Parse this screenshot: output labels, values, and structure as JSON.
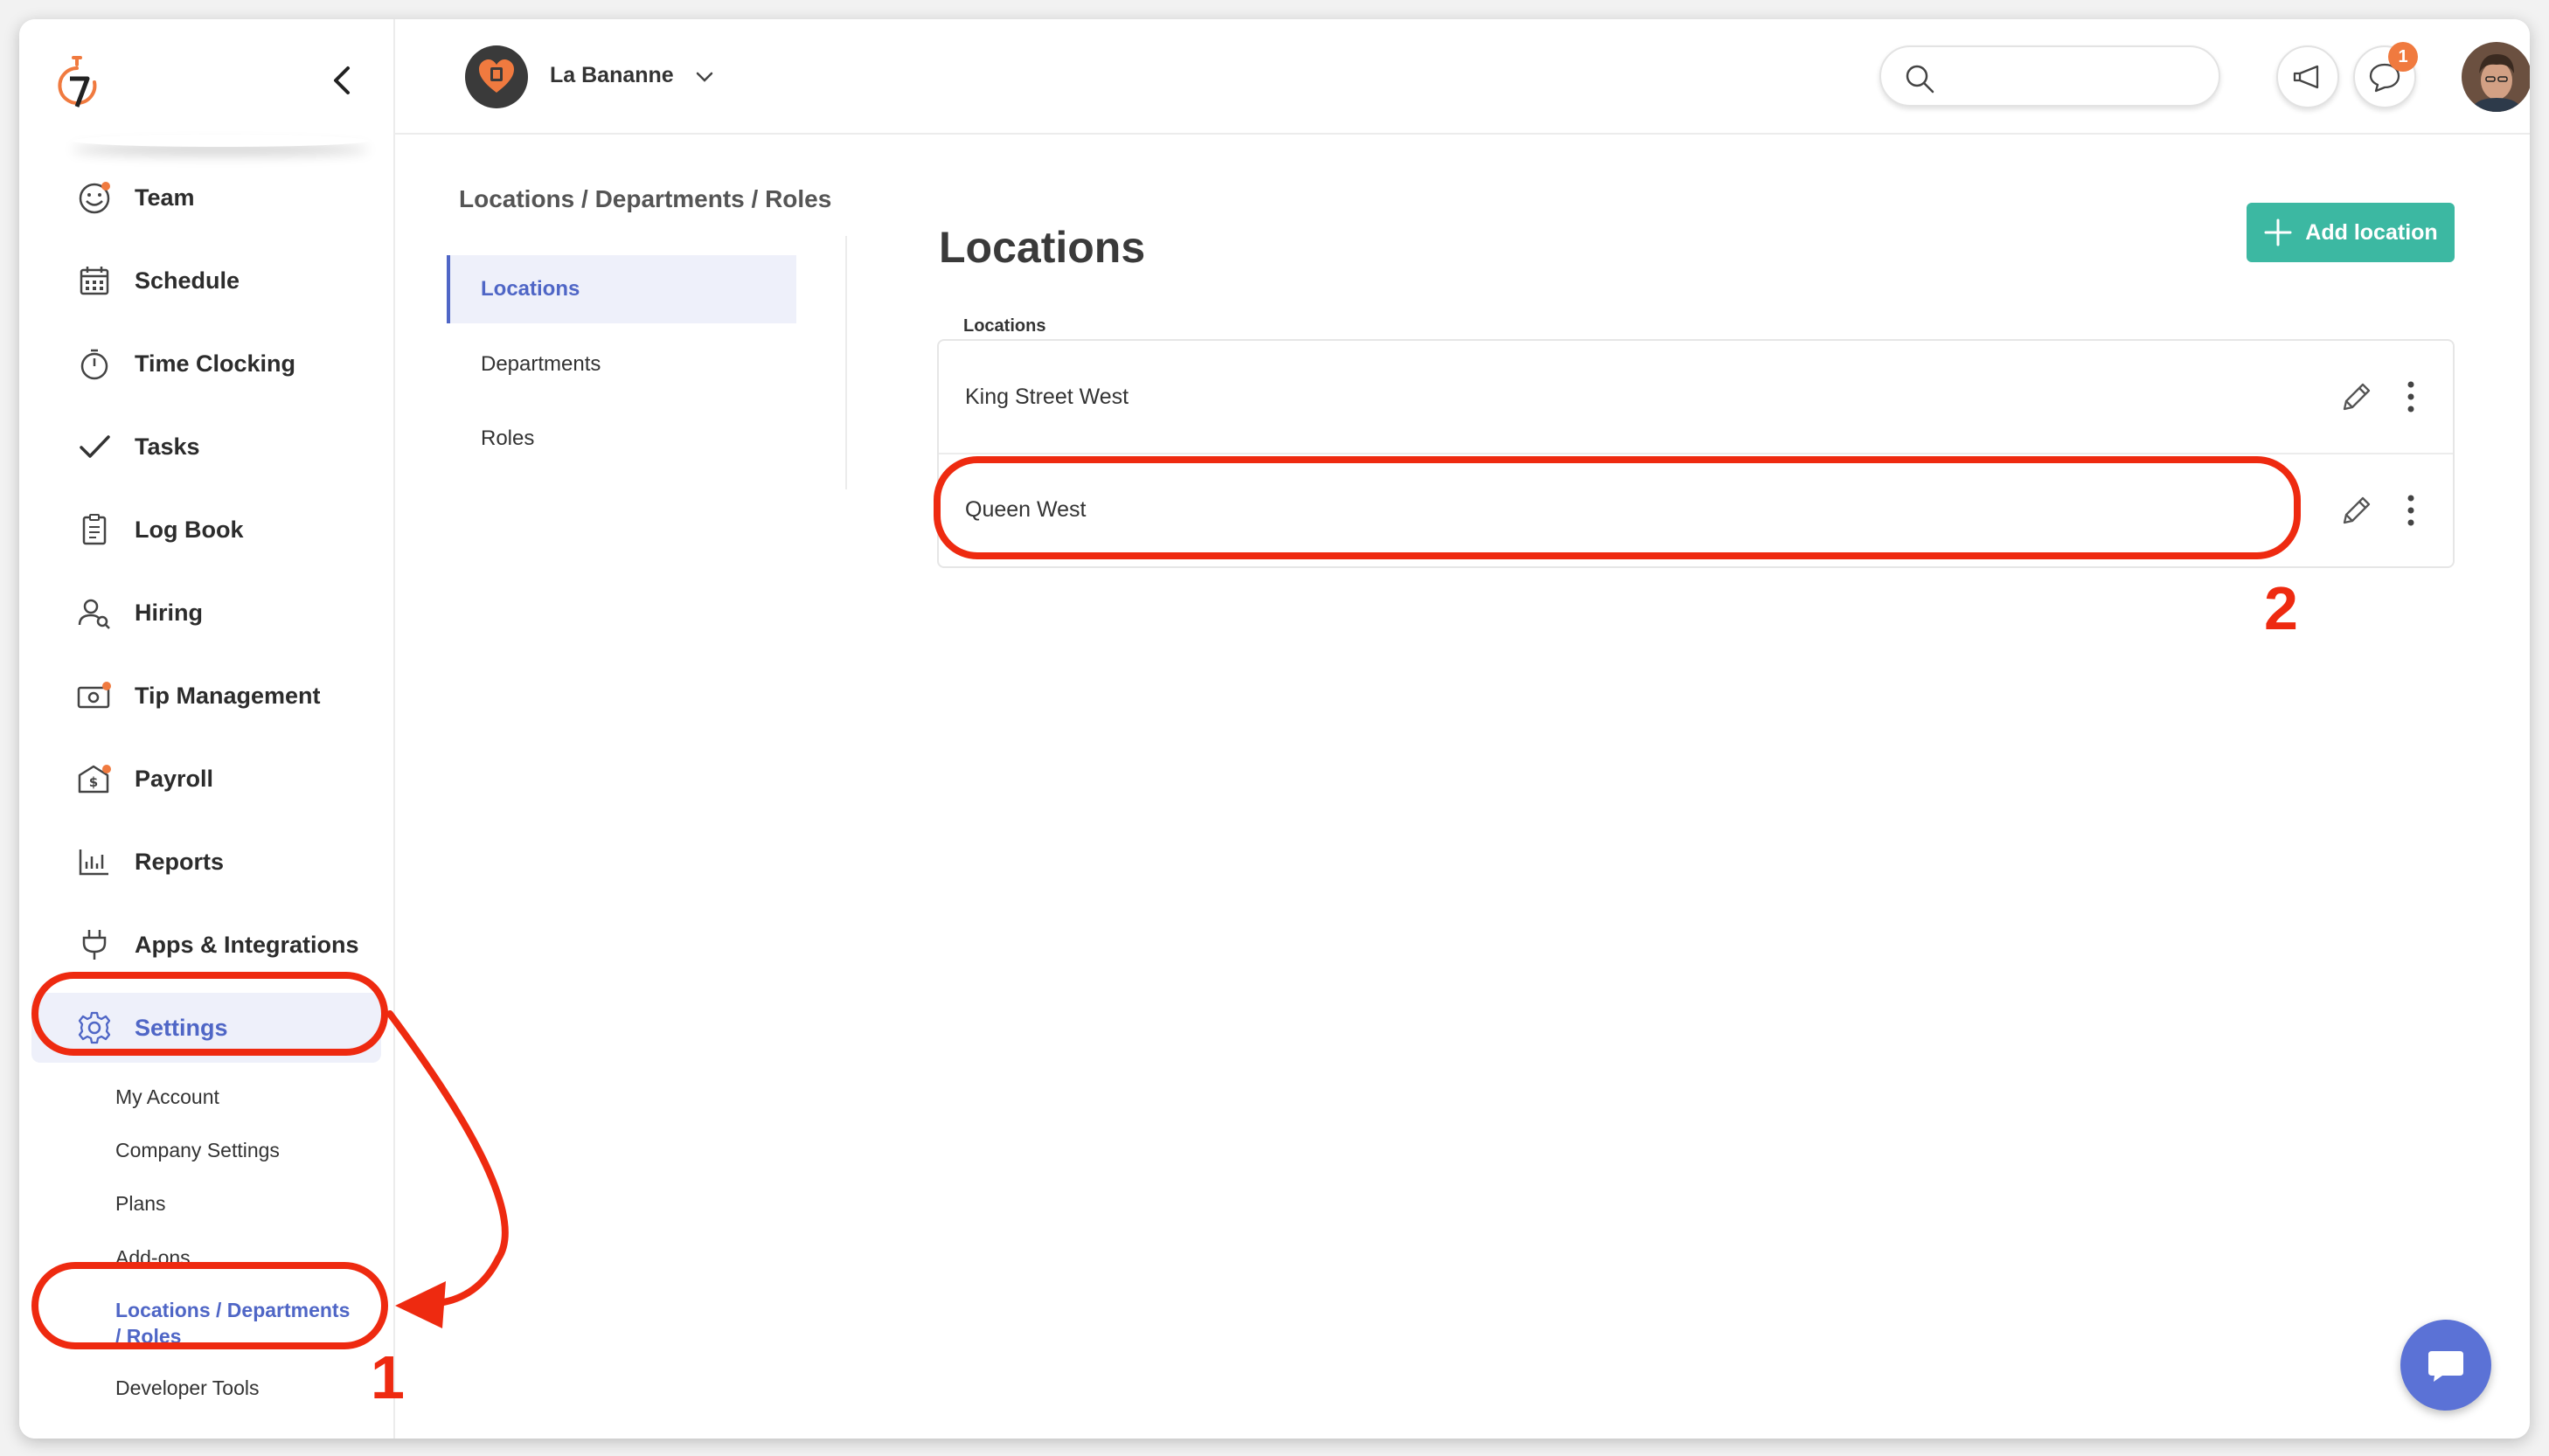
{
  "company": {
    "name": "La Bananne"
  },
  "search": {
    "placeholder": ""
  },
  "notifications": {
    "messages_count": "1"
  },
  "sidebar": {
    "items": [
      {
        "key": "team",
        "label": "Team"
      },
      {
        "key": "schedule",
        "label": "Schedule"
      },
      {
        "key": "time-clocking",
        "label": "Time Clocking"
      },
      {
        "key": "tasks",
        "label": "Tasks"
      },
      {
        "key": "log-book",
        "label": "Log Book"
      },
      {
        "key": "hiring",
        "label": "Hiring"
      },
      {
        "key": "tip-management",
        "label": "Tip Management"
      },
      {
        "key": "payroll",
        "label": "Payroll"
      },
      {
        "key": "reports",
        "label": "Reports"
      },
      {
        "key": "apps-integrations",
        "label": "Apps & Integrations"
      },
      {
        "key": "settings",
        "label": "Settings"
      }
    ],
    "settings_sub": [
      {
        "label": "My Account"
      },
      {
        "label": "Company Settings"
      },
      {
        "label": "Plans"
      },
      {
        "label": "Add-ons"
      },
      {
        "label_line1": "Locations / Departments",
        "label_line2": "/ Roles"
      },
      {
        "label": "Developer Tools"
      }
    ]
  },
  "breadcrumb": "Locations / Departments / Roles",
  "subnav": [
    {
      "label": "Locations"
    },
    {
      "label": "Departments"
    },
    {
      "label": "Roles"
    }
  ],
  "main": {
    "title": "Locations",
    "add_button": "Add location",
    "list_label": "Locations",
    "locations": [
      {
        "name": "King Street West"
      },
      {
        "name": "Queen West"
      }
    ]
  },
  "annotations": {
    "step1": "1",
    "step2": "2"
  },
  "colors": {
    "accent": "#4f66c6",
    "primary_button": "#3cb8a2",
    "annotation": "#ee2a10",
    "badge": "#f07a3f"
  }
}
